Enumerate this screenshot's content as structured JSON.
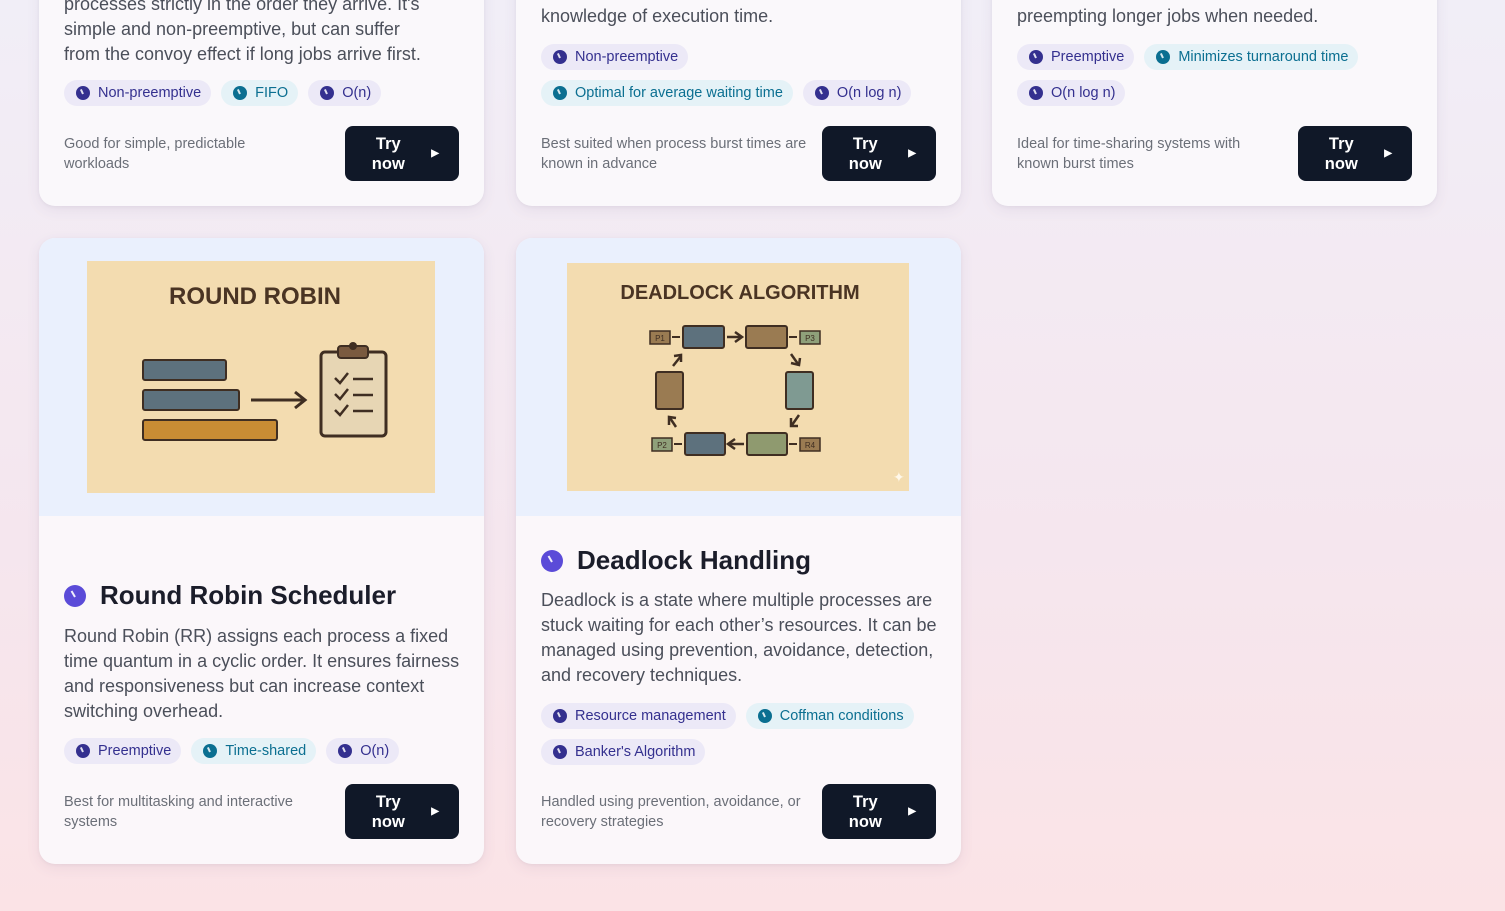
{
  "cards_top": [
    {
      "desc_tail_lines": [
        "processes strictly in the order they arrive. It's",
        "simple and non-preemptive, but can suffer",
        "from the convoy effect if long jobs arrive first."
      ],
      "chips": [
        {
          "label": "Non-preemptive",
          "tone": "indigo"
        },
        {
          "label": "FIFO",
          "tone": "teal"
        },
        {
          "label": "O(n)",
          "tone": "indigo"
        }
      ],
      "note": "Good for simple, predictable workloads",
      "button": "Try now"
    },
    {
      "desc_tail_lines": [
        "knowledge of execution time."
      ],
      "chips": [
        {
          "label": "Non-preemptive",
          "tone": "indigo"
        },
        {
          "label": "Optimal for average waiting time",
          "tone": "teal"
        },
        {
          "label": "O(n log n)",
          "tone": "indigo"
        }
      ],
      "note": "Best suited when process burst times are known in advance",
      "button": "Try now"
    },
    {
      "desc_tail_lines": [
        "preempting longer jobs when needed."
      ],
      "chips": [
        {
          "label": "Preemptive",
          "tone": "indigo"
        },
        {
          "label": "Minimizes turnaround time",
          "tone": "teal"
        },
        {
          "label": "O(n log n)",
          "tone": "indigo"
        }
      ],
      "note": "Ideal for time-sharing systems with known burst times",
      "button": "Try now"
    }
  ],
  "cards_bottom": [
    {
      "image_title": "ROUND ROBIN",
      "title": "Round Robin Scheduler",
      "desc": "Round Robin (RR) assigns each process a fixed time quantum in a cyclic order. It ensures fairness and responsiveness but can increase context switching overhead.",
      "chips": [
        {
          "label": "Preemptive",
          "tone": "indigo"
        },
        {
          "label": "Time-shared",
          "tone": "teal"
        },
        {
          "label": "O(n)",
          "tone": "indigo"
        }
      ],
      "note": "Best for multitasking and interactive systems",
      "button": "Try now"
    },
    {
      "image_title": "DEADLOCK ALGORITHM",
      "image_labels": [
        "P1",
        "P2",
        "P3",
        "R4"
      ],
      "title": "Deadlock Handling",
      "desc": "Deadlock is a state where multiple processes are stuck waiting for each other’s resources. It can be managed using prevention, avoidance, detection, and recovery techniques.",
      "chips": [
        {
          "label": "Resource management",
          "tone": "indigo"
        },
        {
          "label": "Coffman conditions",
          "tone": "teal"
        },
        {
          "label": "Banker's Algorithm",
          "tone": "indigo"
        }
      ],
      "note": "Handled using prevention, avoidance, or recovery strategies",
      "button": "Try now"
    }
  ],
  "colors": {
    "indigo": "#34308f",
    "teal": "#0b6f91",
    "button": "#101828",
    "accent_icon": "#5b4bd8"
  }
}
